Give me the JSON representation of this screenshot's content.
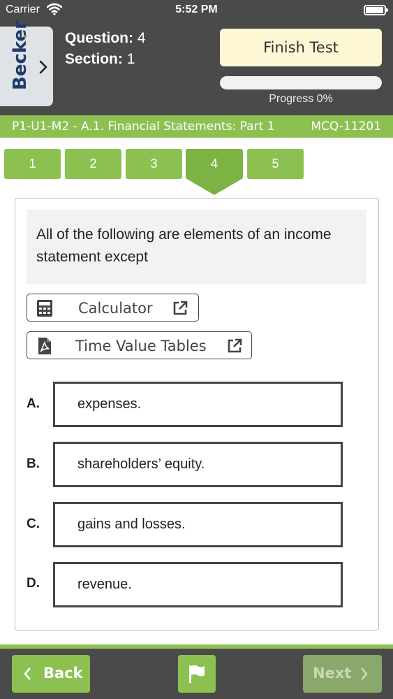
{
  "status_bar": {
    "carrier": "Carrier",
    "time": "5:52 PM"
  },
  "sidebar_tab": {
    "brand": "Becker"
  },
  "question_info": {
    "question_label": "Question:",
    "question_number": "4",
    "section_label": "Section:",
    "section_number": "1"
  },
  "finish_test": {
    "label": "Finish Test"
  },
  "progress": {
    "value": 0,
    "label": "Progress 0%"
  },
  "topic": {
    "title": "P1-U1-M2 - A.1. Financial Statements: Part 1",
    "question_id": "MCQ-11201"
  },
  "question_tabs": [
    {
      "label": "1"
    },
    {
      "label": "2"
    },
    {
      "label": "3"
    },
    {
      "label": "4",
      "active": true
    },
    {
      "label": "5"
    }
  ],
  "question": {
    "stem": "All of the following are elements of an income statement except"
  },
  "tools": {
    "calculator": {
      "label": "Calculator",
      "icon": "calculator-icon"
    },
    "time_value_tables": {
      "label": "Time Value Tables",
      "icon": "pdf-icon"
    }
  },
  "options": [
    {
      "letter": "A.",
      "text": "expenses."
    },
    {
      "letter": "B.",
      "text": "shareholders’ equity."
    },
    {
      "letter": "C.",
      "text": "gains and losses."
    },
    {
      "letter": "D.",
      "text": "revenue."
    }
  ],
  "footer": {
    "back_label": "Back",
    "next_label": "Next",
    "flag_icon": "flag-icon"
  },
  "colors": {
    "accent_green": "#8cc152",
    "header_dark": "#4a4a4a",
    "finish_bg": "#fdf7d6",
    "brand_navy": "#1f3c6b"
  }
}
